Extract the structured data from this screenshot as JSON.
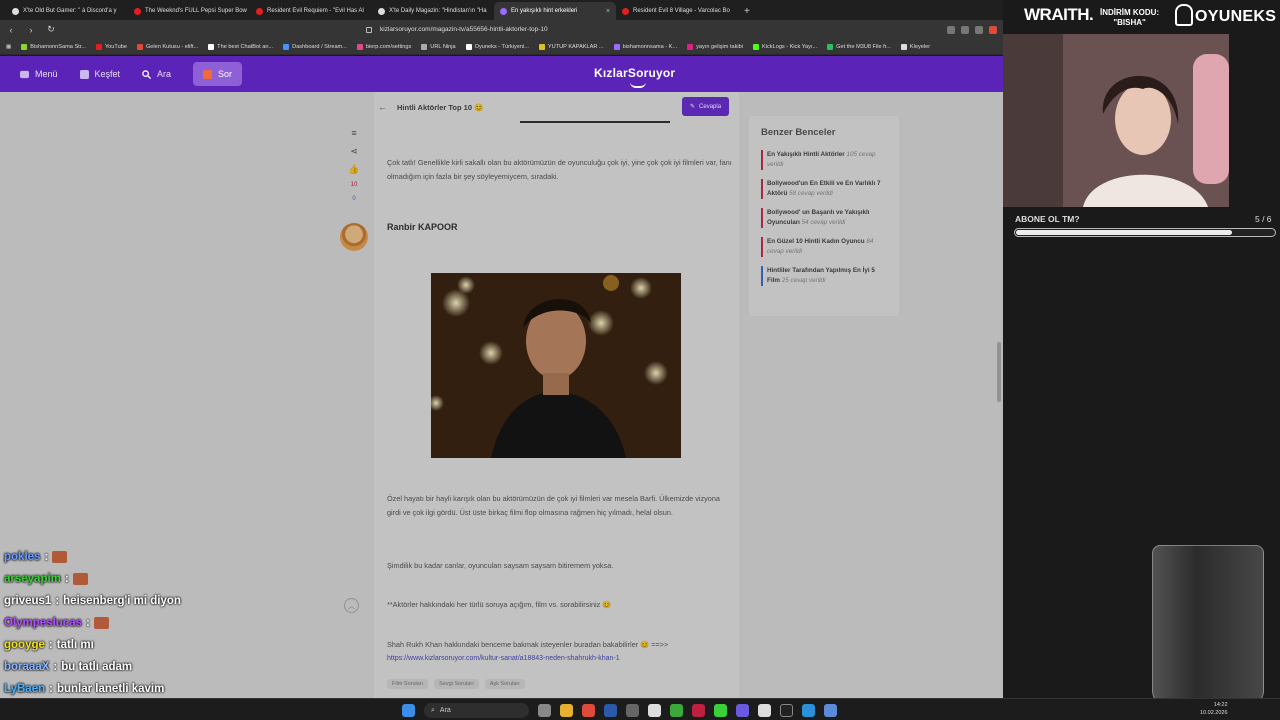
{
  "browser": {
    "tabs": [
      {
        "label": "X'te Old But Gamer: \" à Discord'a y",
        "color": "#ddd",
        "active": false
      },
      {
        "label": "The Weeknd's FULL Pepsi Super Bow",
        "color": "#e02020",
        "active": false
      },
      {
        "label": "Resident Evil Requiem - \"Evil Has Al",
        "color": "#e02020",
        "active": false
      },
      {
        "label": "X'te Daily Magazin: \"Hindistan'ın \"Ha",
        "color": "#ddd",
        "active": false
      },
      {
        "label": "En yakışıklı hint erkekleri",
        "color": "#9a6cff",
        "active": true
      },
      {
        "label": "Resident Evil 8 Village - Varcolac Bo",
        "color": "#e02020",
        "active": false
      }
    ],
    "new_tab": "+",
    "url": "kizlarsoruyor.com/magazin-tv/a55656-hintli-aktorler-top-10",
    "bookmarks": [
      {
        "label": "BishamonnSama Str...",
        "color": "#8bd42a"
      },
      {
        "label": "YouTube",
        "color": "#e02020"
      },
      {
        "label": "Gelen Kutusu - elift...",
        "color": "#e04a3a"
      },
      {
        "label": "The best ChatBot an...",
        "color": "#ffffff"
      },
      {
        "label": "Dashboard / Stream...",
        "color": "#4a90ff"
      },
      {
        "label": "bierp.com/settings",
        "color": "#e04a8a"
      },
      {
        "label": "URL Ninja",
        "color": "#aaaaaa"
      },
      {
        "label": "Oyuneks - Türkiyeni...",
        "color": "#ffffff"
      },
      {
        "label": "YUTUP KAPAKLAR ...",
        "color": "#e0c020"
      },
      {
        "label": "bishamonnsama - K...",
        "color": "#9a6cff"
      },
      {
        "label": "yayın gelişim takibi",
        "color": "#e02080"
      },
      {
        "label": "KickLogs - Kick Yayı...",
        "color": "#53fc18"
      },
      {
        "label": "Get the M3U8 File fr...",
        "color": "#2ac060"
      },
      {
        "label": "Kleyeler",
        "color": "#dddddd"
      }
    ]
  },
  "site": {
    "nav": {
      "menu": "Menü",
      "explore": "Keşfet",
      "search": "Ara",
      "ask": "Sor"
    },
    "logo": "KızlarSoruyor"
  },
  "article": {
    "title": "Hintli Aktörler Top 10 😊",
    "answer_button": "Cevapla",
    "likes": "10",
    "dislikes": "0",
    "para1": "Çok tatlı! Genellikle kirli sakallı olan bu aktörümüzün de oyunculuğu çok iyi, yine çok çok iyi filmleri var, fanı olmadığım için fazla bir şey söyleyemiycem, sıradaki.",
    "subhead": "Ranbir KAPOOR",
    "para2": "Özel hayatı bir hayli karışık olan bu aktörümüzün de çok iyi filmleri var mesela Barfi. Ülkemizde vizyona girdi ve çok ilgi gördü. Üst üste birkaç filmi flop olmasına rağmen hiç yılmadı, helal olsun.",
    "para3": "Şimdilik bu kadar canlar, oyuncuları saysam saysam bitiremem yoksa.",
    "para4": "**Aktörler hakkındaki her türlü soruya açığım, film vs. sorabilirsiniz 😊",
    "para5": "Shah Rukh Khan hakkındaki benceme bakmak isteyenler buradan bakabilirler 😊 ==>>",
    "link": "https://www.kizlarsoruyor.com/kultur-sanat/a18843-neden-shahrukh-khan-1",
    "tags": [
      "Film Soruları",
      "Sevgi Soruları",
      "Aşk Soruları"
    ]
  },
  "similar": {
    "title": "Benzer Benceler",
    "items": [
      {
        "label": "En Yakışıklı Hintli Aktörler",
        "count": "105 cevap verildi"
      },
      {
        "label": "Bollywood'un En Etkili ve En Varlıklı 7 Aktörü",
        "count": "58 cevap verildi"
      },
      {
        "label": "Bollywood' un Başarılı ve Yakışıklı Oyuncuları",
        "count": "54 cevap verildi"
      },
      {
        "label": "En Güzel 10 Hintli Kadın Oyuncu",
        "count": "84 cevap verildi"
      },
      {
        "label": "Hintliler Tarafından Yapılmış En İyi 5 Film",
        "count": "25 cevap verildi"
      }
    ]
  },
  "overlay": {
    "brand": "WRAITH.",
    "promo_line1": "İNDİRİM KODU:",
    "promo_line2": "\"BISHA\"",
    "sponsor": "OYUNEKS",
    "sub_goal_label": "ABONE OL TM?",
    "sub_goal_count": "5 / 6",
    "sub_goal_fraction": 0.83
  },
  "chat": [
    {
      "user": "pokles",
      "color": "#6a9bff",
      "msg": "",
      "emote": true
    },
    {
      "user": "arseyapim",
      "color": "#3ad03a",
      "msg": "",
      "emote": true
    },
    {
      "user": "griveus1",
      "color": "#ffffff",
      "msg": "heisenberg'i mi diyon",
      "emote": false
    },
    {
      "user": "Olympeslucas",
      "color": "#b050ff",
      "msg": "",
      "emote": true
    },
    {
      "user": "gooyge",
      "color": "#f0e020",
      "msg": "tatlı mı",
      "emote": false
    },
    {
      "user": "boraaaX",
      "color": "#8ab4ff",
      "msg": "bu tatlı adam",
      "emote": false
    },
    {
      "user": "LyBaen",
      "color": "#4ab0ff",
      "msg": "bunlar lanetli kavim",
      "emote": false
    },
    {
      "user": "gooyge",
      "color": "#f0e020",
      "msg": "",
      "emote": true
    }
  ],
  "taskbar": {
    "search": "Ara",
    "time": "14:22",
    "date": "10.02.2026",
    "lang": "TRQ"
  }
}
